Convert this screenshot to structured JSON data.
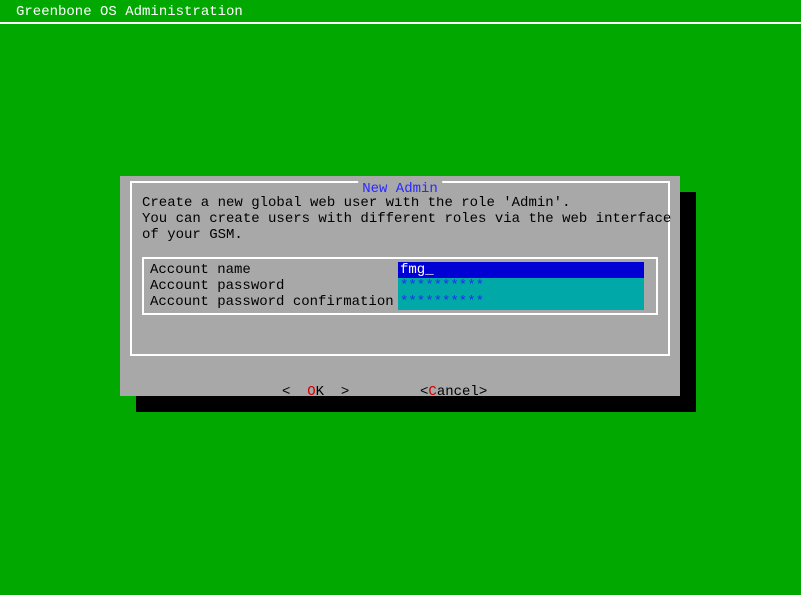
{
  "header": {
    "title": "Greenbone OS Administration"
  },
  "dialog": {
    "title": "New Admin",
    "description_line1": "Create a new global web user with the role 'Admin'.",
    "description_line2": "You can create users with different roles via the web interface",
    "description_line3": "of your GSM.",
    "form": {
      "account_name_label": "Account name",
      "account_name_value": "fmg_",
      "account_password_label": "Account password",
      "account_password_value": "**********",
      "account_password_confirm_label": "Account password confirmation",
      "account_password_confirm_value": "**********"
    },
    "buttons": {
      "ok_before": "<  ",
      "ok_hotkey": "O",
      "ok_after": "K  >",
      "cancel_before": "<",
      "cancel_hotkey": "C",
      "cancel_after": "ancel>"
    }
  }
}
